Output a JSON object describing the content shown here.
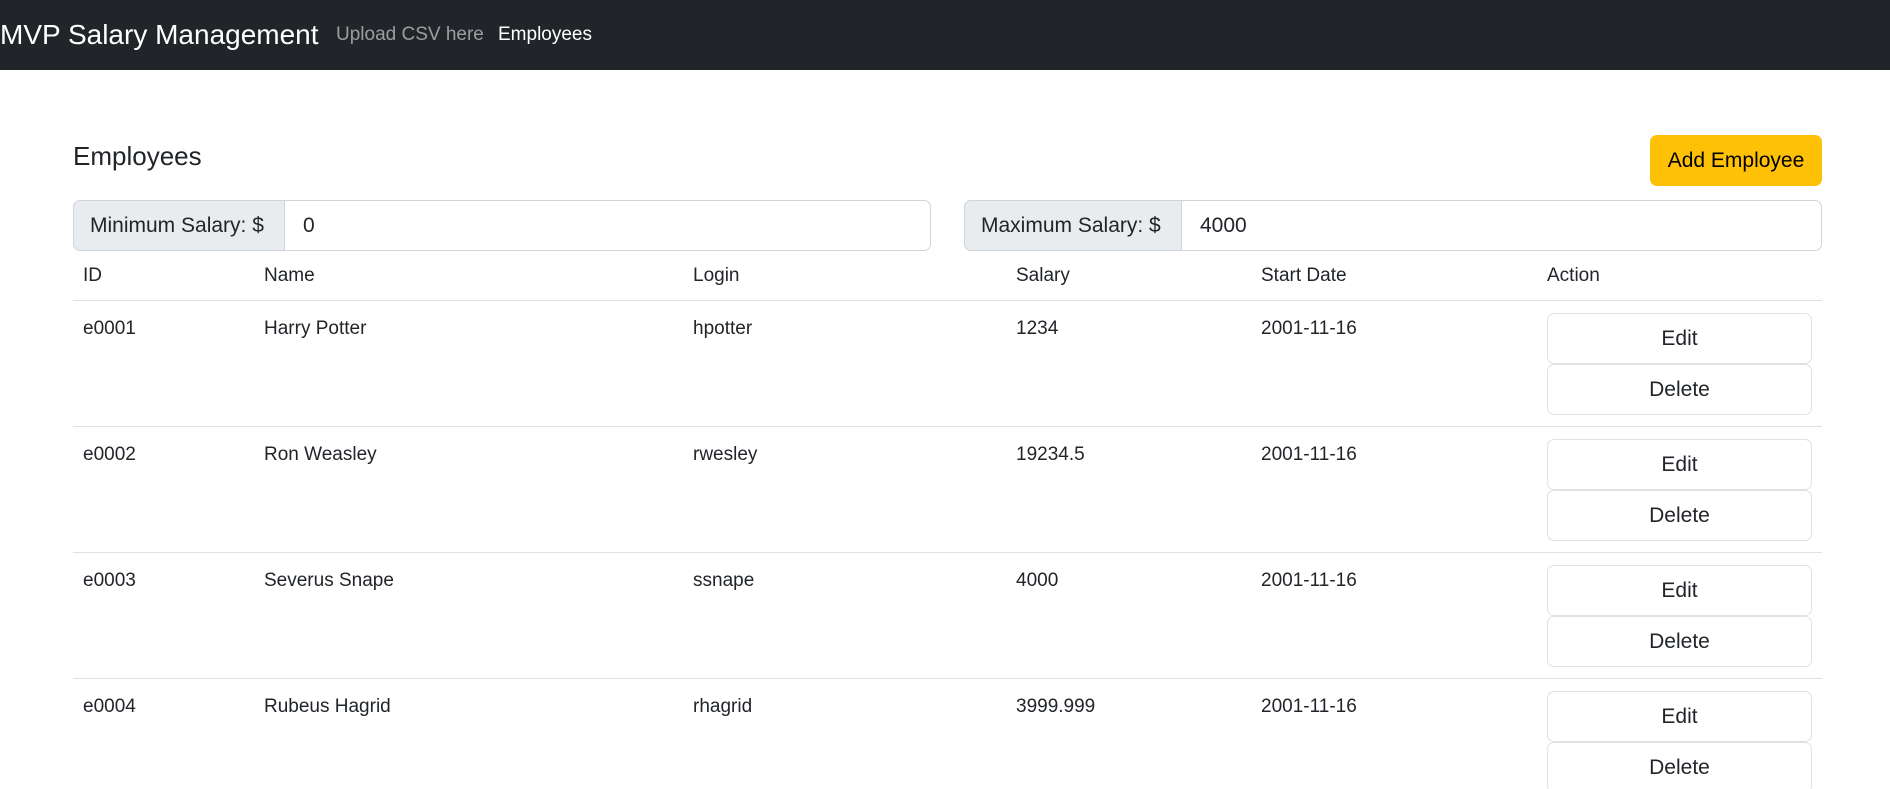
{
  "navbar": {
    "brand": "MVP Salary Management",
    "links": [
      {
        "label": "Upload CSV here"
      },
      {
        "label": "Employees"
      }
    ]
  },
  "page": {
    "title": "Employees",
    "add_button_label": "Add Employee"
  },
  "filters": {
    "min_label": "Minimum Salary: $",
    "min_value": "0",
    "max_label": "Maximum Salary: $",
    "max_value": "4000"
  },
  "table": {
    "headers": [
      "ID",
      "Name",
      "Login",
      "Salary",
      "Start Date",
      "Action"
    ],
    "rows": [
      {
        "id": "e0001",
        "name": "Harry Potter",
        "login": "hpotter",
        "salary": "1234",
        "start_date": "2001-11-16"
      },
      {
        "id": "e0002",
        "name": "Ron Weasley",
        "login": "rwesley",
        "salary": "19234.5",
        "start_date": "2001-11-16"
      },
      {
        "id": "e0003",
        "name": "Severus Snape",
        "login": "ssnape",
        "salary": "4000",
        "start_date": "2001-11-16"
      },
      {
        "id": "e0004",
        "name": "Rubeus Hagrid",
        "login": "rhagrid",
        "salary": "3999.999",
        "start_date": "2001-11-16"
      }
    ],
    "edit_label": "Edit",
    "delete_label": "Delete"
  },
  "colors": {
    "navbar_bg": "#212529",
    "accent_warning": "#ffc107",
    "border": "#dee2e6",
    "addon_bg": "#e9ecef"
  }
}
